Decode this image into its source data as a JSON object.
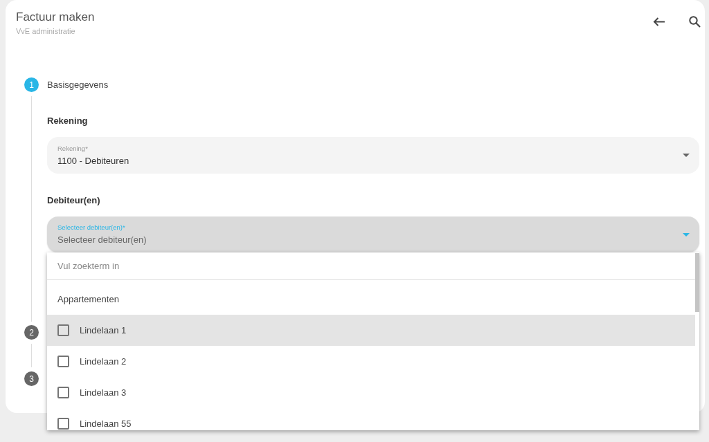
{
  "header": {
    "title": "Factuur maken",
    "subtitle": "VvE administratie"
  },
  "stepper": {
    "steps": [
      {
        "number": "1",
        "label": "Basisgegevens",
        "active": true,
        "sections": [
          {
            "heading": "Rekening",
            "field": {
              "label": "Rekening*",
              "value": "1100 - Debiteuren",
              "focused": false
            }
          },
          {
            "heading": "Debiteur(en)",
            "field": {
              "label": "Selecteer debiteur(en)*",
              "placeholder": "Selecteer debiteur(en)",
              "focused": true,
              "dropdown": {
                "search": {
                  "placeholder": "Vul zoekterm in"
                },
                "group": "Appartementen",
                "options": [
                  {
                    "label": "Lindelaan 1",
                    "checked": false,
                    "highlighted": true
                  },
                  {
                    "label": "Lindelaan 2",
                    "checked": false,
                    "highlighted": false
                  },
                  {
                    "label": "Lindelaan 3",
                    "checked": false,
                    "highlighted": false
                  },
                  {
                    "label": "Lindelaan 55",
                    "checked": false,
                    "highlighted": false
                  }
                ]
              }
            }
          }
        ]
      },
      {
        "number": "2",
        "active": false
      },
      {
        "number": "3",
        "active": false
      }
    ]
  }
}
